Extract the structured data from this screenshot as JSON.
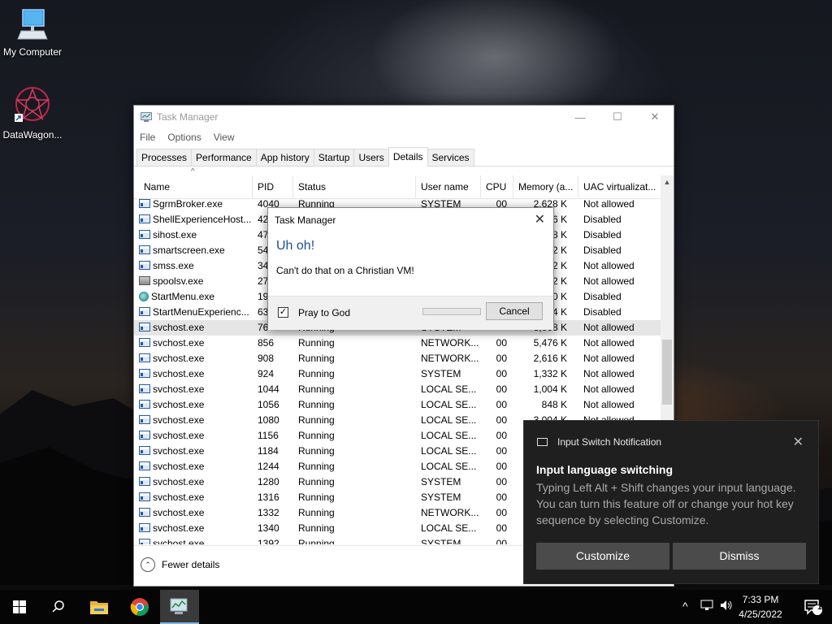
{
  "desktop": {
    "icons": [
      {
        "label": "My Computer",
        "icon": "computer-icon"
      },
      {
        "label": "DataWagon...",
        "icon": "datawagon-shortcut-icon"
      }
    ]
  },
  "task_manager": {
    "title": "Task Manager",
    "menu": [
      "File",
      "Options",
      "View"
    ],
    "tabs": [
      "Processes",
      "Performance",
      "App history",
      "Startup",
      "Users",
      "Details",
      "Services"
    ],
    "active_tab": "Details",
    "columns": [
      "Name",
      "PID",
      "Status",
      "User name",
      "CPU",
      "Memory (a...",
      "UAC virtualizat..."
    ],
    "rows": [
      {
        "name": "SgrmBroker.exe",
        "pid": "4040",
        "status": "Running",
        "user": "SYSTEM",
        "cpu": "00",
        "mem": "2,628 K",
        "uac": "Not allowed"
      },
      {
        "name": "ShellExperienceHost....",
        "pid": "42",
        "status": "",
        "user": "",
        "cpu": "",
        "mem": "316 K",
        "uac": "Disabled"
      },
      {
        "name": "sihost.exe",
        "pid": "47",
        "status": "",
        "user": "",
        "cpu": "",
        "mem": "28 K",
        "uac": "Disabled"
      },
      {
        "name": "smartscreen.exe",
        "pid": "54",
        "status": "",
        "user": "",
        "cpu": "",
        "mem": "32 K",
        "uac": "Disabled"
      },
      {
        "name": "smss.exe",
        "pid": "34",
        "status": "",
        "user": "",
        "cpu": "",
        "mem": "52 K",
        "uac": "Not allowed"
      },
      {
        "name": "spoolsv.exe",
        "pid": "27",
        "status": "",
        "user": "",
        "cpu": "",
        "mem": "72 K",
        "uac": "Not allowed"
      },
      {
        "name": "StartMenu.exe",
        "pid": "19",
        "status": "",
        "user": "",
        "cpu": "",
        "mem": "00 K",
        "uac": "Disabled"
      },
      {
        "name": "StartMenuExperienc...",
        "pid": "63",
        "status": "",
        "user": "",
        "cpu": "",
        "mem": "24 K",
        "uac": "Disabled"
      },
      {
        "name": "svchost.exe",
        "pid": "76",
        "status": "Running",
        "user": "SYSTEM",
        "cpu": "",
        "mem": "8,068 K",
        "uac": "Not allowed"
      },
      {
        "name": "svchost.exe",
        "pid": "856",
        "status": "Running",
        "user": "NETWORK...",
        "cpu": "00",
        "mem": "5,476 K",
        "uac": "Not allowed"
      },
      {
        "name": "svchost.exe",
        "pid": "908",
        "status": "Running",
        "user": "NETWORK...",
        "cpu": "00",
        "mem": "2,616 K",
        "uac": "Not allowed"
      },
      {
        "name": "svchost.exe",
        "pid": "924",
        "status": "Running",
        "user": "SYSTEM",
        "cpu": "00",
        "mem": "1,332 K",
        "uac": "Not allowed"
      },
      {
        "name": "svchost.exe",
        "pid": "1044",
        "status": "Running",
        "user": "LOCAL SE...",
        "cpu": "00",
        "mem": "1,004 K",
        "uac": "Not allowed"
      },
      {
        "name": "svchost.exe",
        "pid": "1056",
        "status": "Running",
        "user": "LOCAL SE...",
        "cpu": "00",
        "mem": "848 K",
        "uac": "Not allowed"
      },
      {
        "name": "svchost.exe",
        "pid": "1080",
        "status": "Running",
        "user": "LOCAL SE...",
        "cpu": "00",
        "mem": "3,004 K",
        "uac": "Not allowed"
      },
      {
        "name": "svchost.exe",
        "pid": "1156",
        "status": "Running",
        "user": "LOCAL SE...",
        "cpu": "00",
        "mem": "",
        "uac": ""
      },
      {
        "name": "svchost.exe",
        "pid": "1184",
        "status": "Running",
        "user": "LOCAL SE...",
        "cpu": "00",
        "mem": "",
        "uac": ""
      },
      {
        "name": "svchost.exe",
        "pid": "1244",
        "status": "Running",
        "user": "LOCAL SE...",
        "cpu": "00",
        "mem": "",
        "uac": ""
      },
      {
        "name": "svchost.exe",
        "pid": "1280",
        "status": "Running",
        "user": "SYSTEM",
        "cpu": "00",
        "mem": "",
        "uac": ""
      },
      {
        "name": "svchost.exe",
        "pid": "1316",
        "status": "Running",
        "user": "SYSTEM",
        "cpu": "00",
        "mem": "",
        "uac": ""
      },
      {
        "name": "svchost.exe",
        "pid": "1332",
        "status": "Running",
        "user": "NETWORK...",
        "cpu": "00",
        "mem": "",
        "uac": ""
      },
      {
        "name": "svchost.exe",
        "pid": "1340",
        "status": "Running",
        "user": "LOCAL SE...",
        "cpu": "00",
        "mem": "",
        "uac": ""
      },
      {
        "name": "svchost.exe",
        "pid": "1392",
        "status": "Running",
        "user": "SYSTEM",
        "cpu": "00",
        "mem": "",
        "uac": ""
      }
    ],
    "selected_row": 8,
    "fewer_details": "Fewer details"
  },
  "dialog": {
    "title": "Task Manager",
    "heading": "Uh oh!",
    "message": "Can't do that on a Christian VM!",
    "checkbox_label": "Pray to God",
    "checkbox_checked": true,
    "cancel_label": "Cancel"
  },
  "toast": {
    "app_name": "Input Switch Notification",
    "title": "Input language switching",
    "body": "Typing Left Alt + Shift changes your input language. You can turn this feature off or change your hot key sequence by selecting Customize.",
    "customize_label": "Customize",
    "dismiss_label": "Dismiss"
  },
  "taskbar": {
    "time": "7:33 PM",
    "date": "4/25/2022",
    "notification_count": "1"
  }
}
